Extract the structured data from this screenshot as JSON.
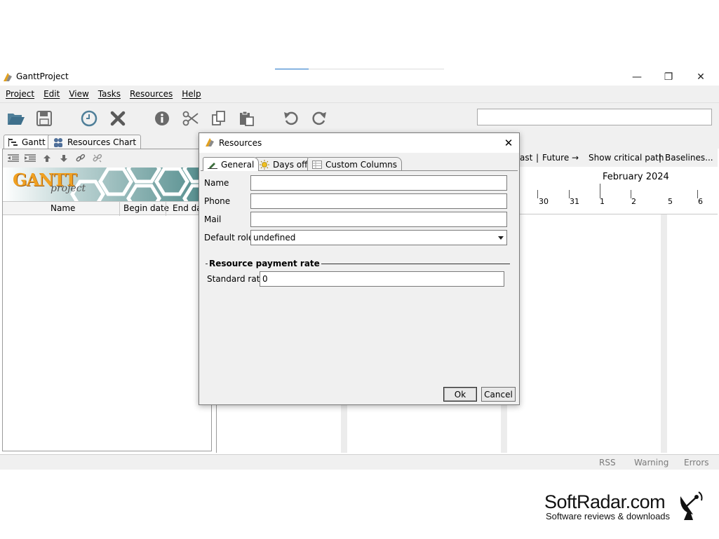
{
  "app": {
    "title": "GanttProject"
  },
  "window_controls": {
    "minimize": "—",
    "maximize": "❐",
    "close": "✕"
  },
  "menu": [
    "Project",
    "Edit",
    "View",
    "Tasks",
    "Resources",
    "Help"
  ],
  "toolbar": {
    "icons": [
      "open-folder-icon",
      "save-icon",
      "clock-icon",
      "delete-icon",
      "info-icon",
      "cut-icon",
      "copy-icon",
      "paste-icon",
      "undo-icon",
      "redo-icon"
    ],
    "search_value": ""
  },
  "main_tabs": [
    {
      "label": "Gantt"
    },
    {
      "label": "Resources Chart"
    }
  ],
  "task_table": {
    "columns": [
      "Name",
      "Begin date",
      "End da"
    ]
  },
  "banner": {
    "logo_main": "GANTT",
    "logo_sub": "project"
  },
  "chart_toolbar": {
    "past": "ast",
    "sep1": "|",
    "future": "Future →",
    "show_critical_path": "Show critical path",
    "sep2": "|",
    "baselines": "Baselines..."
  },
  "timeline": {
    "month": "February 2024",
    "days": [
      "30",
      "31",
      "1",
      "2",
      "5",
      "6"
    ]
  },
  "status_bar": {
    "rss": "RSS",
    "warning": "Warning",
    "errors": "Errors"
  },
  "watermark": {
    "title": "SoftRadar.com",
    "subtitle": "Software reviews & downloads"
  },
  "dialog": {
    "title": "Resources",
    "close": "✕",
    "tabs": [
      {
        "label": "General"
      },
      {
        "label": "Days off"
      },
      {
        "label": "Custom Columns"
      }
    ],
    "fields": {
      "name_label": "Name",
      "name_value": "",
      "phone_label": "Phone",
      "phone_value": "",
      "mail_label": "Mail",
      "mail_value": "",
      "role_label": "Default role",
      "role_value": "undefined"
    },
    "payment": {
      "section_title": "Resource payment rate",
      "rate_label": "Standard rate",
      "rate_value": "0"
    },
    "buttons": {
      "ok": "Ok",
      "cancel": "Cancel"
    }
  }
}
